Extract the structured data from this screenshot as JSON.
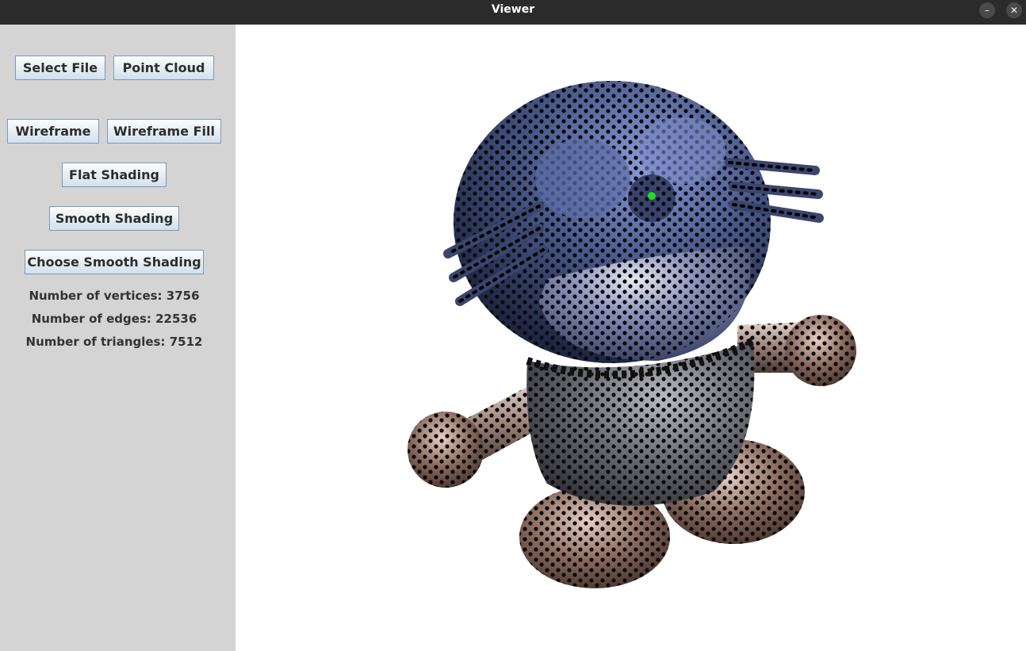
{
  "window": {
    "title": "Viewer",
    "minimize_glyph": "–",
    "close_glyph": "✕"
  },
  "toolbar": {
    "select_file": "Select File",
    "point_cloud": "Point Cloud",
    "wireframe": "Wireframe",
    "wireframe_fill": "Wireframe Fill",
    "flat_shading": "Flat Shading",
    "smooth_shading": "Smooth Shading",
    "choose_smooth_shading": "Choose Smooth Shading"
  },
  "stats": {
    "vertices": "Number of vertices: 3756",
    "edges": "Number of edges: 22536",
    "triangles": "Number of triangles: 7512"
  },
  "viewport": {
    "model_icon": "3d-model-point-cloud",
    "colors": {
      "head": "#4a5a8c",
      "body": "#6a6a72",
      "limbs": "#8a6a5e",
      "selected_point": "#22dd22"
    }
  }
}
